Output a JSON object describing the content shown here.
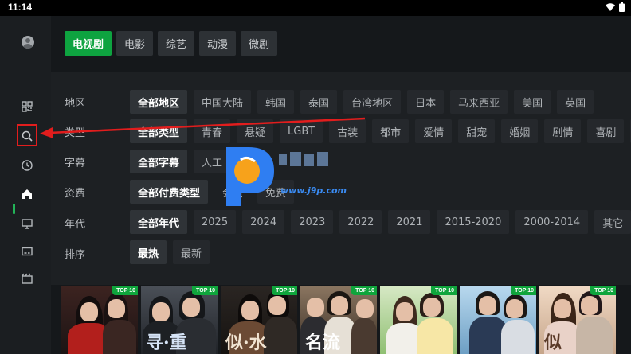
{
  "status_bar": {
    "time": "11:14"
  },
  "tabs": [
    {
      "label": "电视剧",
      "active": true
    },
    {
      "label": "电影"
    },
    {
      "label": "综艺"
    },
    {
      "label": "动漫"
    },
    {
      "label": "微剧"
    }
  ],
  "filters": {
    "region": {
      "label": "地区",
      "options": [
        "全部地区",
        "中国大陆",
        "韩国",
        "泰国",
        "台湾地区",
        "日本",
        "马来西亚",
        "美国",
        "英国"
      ]
    },
    "type": {
      "label": "类型",
      "options": [
        "全部类型",
        "青春",
        "悬疑",
        "LGBT",
        "古装",
        "都市",
        "爱情",
        "甜宠",
        "婚姻",
        "剧情",
        "喜剧",
        "家"
      ]
    },
    "subtitle": {
      "label": "字幕",
      "options": [
        "全部字幕",
        "人工"
      ]
    },
    "payment": {
      "label": "资费",
      "options": [
        "全部付费类型",
        "会员",
        "免费"
      ]
    },
    "year": {
      "label": "年代",
      "options": [
        "全部年代",
        "2025",
        "2024",
        "2023",
        "2022",
        "2021",
        "2015-2020",
        "2000-2014",
        "其它"
      ]
    },
    "sort": {
      "label": "排序",
      "options": [
        "最热",
        "最新"
      ]
    }
  },
  "posters": [
    {
      "badge": "TOP 10"
    },
    {
      "badge": "TOP 10",
      "title": "寻·重"
    },
    {
      "badge": "TOP 10",
      "title": "似·水"
    },
    {
      "badge": "TOP 10",
      "title": "名流"
    },
    {
      "badge": "TOP 10"
    },
    {
      "badge": "TOP 10"
    },
    {
      "badge": "TOP 10",
      "title": "似"
    }
  ],
  "watermark": {
    "url": "www.j9p.com",
    "brand": "精品下载"
  },
  "colors": {
    "accent": "#0ea340",
    "annotation": "#e21d1d",
    "badge": "#0fa53c"
  },
  "icons": [
    "grid-icon",
    "search-icon",
    "history-icon",
    "home-icon",
    "tv-icon",
    "subtitle-icon",
    "clapperboard-icon"
  ]
}
